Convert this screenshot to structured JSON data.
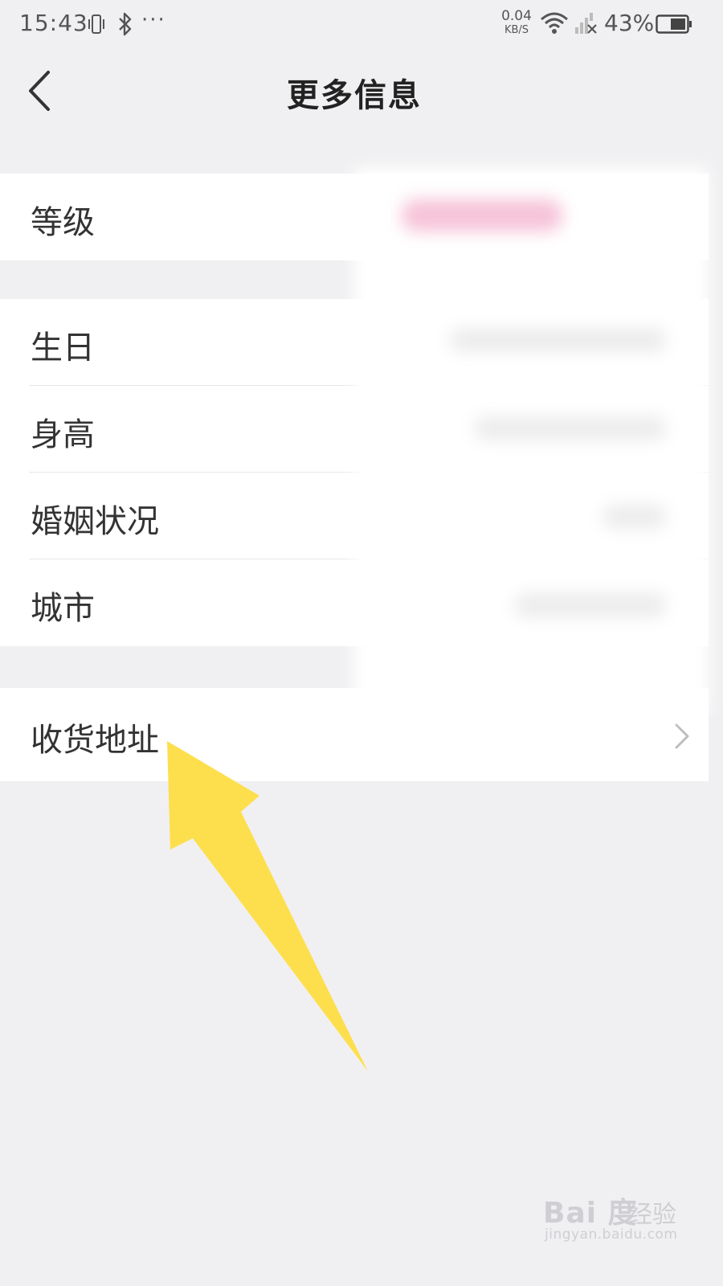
{
  "status_bar": {
    "time": "15:43",
    "network_speed_value": "0.04",
    "network_speed_unit": "KB/S",
    "battery_percent": "43%",
    "icons": [
      "vibrate-icon",
      "bluetooth-icon",
      "more-dots-icon",
      "wifi-icon",
      "signal-icon",
      "battery-icon"
    ],
    "dots": "···"
  },
  "header": {
    "title": "更多信息",
    "back_icon": "chevron-left-icon"
  },
  "groups": [
    {
      "rows": [
        {
          "label": "等级"
        }
      ]
    },
    {
      "rows": [
        {
          "label": "生日"
        },
        {
          "label": "身高"
        },
        {
          "label": "婚姻状况"
        },
        {
          "label": "城市"
        }
      ]
    },
    {
      "rows": [
        {
          "label": "收货地址",
          "chevron": "chevron-right-icon"
        }
      ]
    }
  ],
  "annotation": {
    "type": "arrow",
    "color": "#fddf4e"
  },
  "watermark": {
    "brand": "Bai 度",
    "suffix": "经验",
    "url": "jingyan.baidu.com"
  },
  "colors": {
    "background": "#f0f0f2",
    "row_background": "#ffffff",
    "text": "#333333",
    "arrow": "#fddf4e",
    "blur_accent": "#f6c3d8"
  }
}
